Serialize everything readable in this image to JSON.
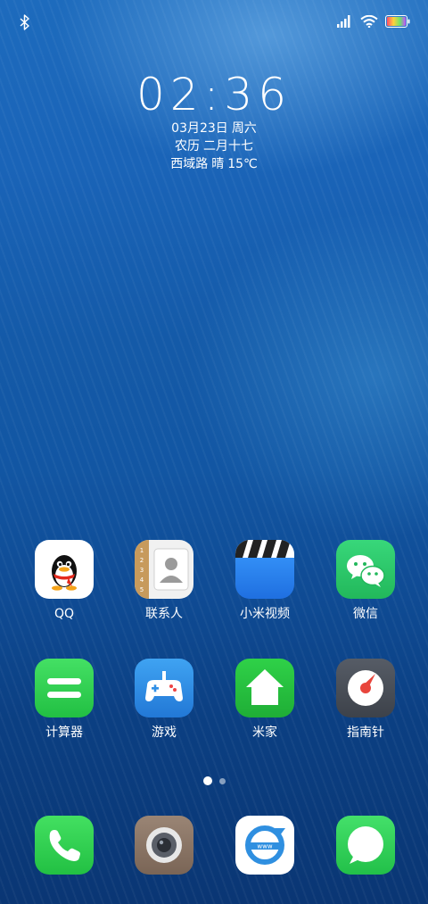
{
  "statusbar": {
    "bluetooth": "bluetooth-icon",
    "signal": "signal-icon",
    "wifi": "wifi-icon",
    "battery": "battery-icon"
  },
  "lockinfo": {
    "time": "02:36",
    "date": "03月23日",
    "weekday": "周六",
    "lunar_prefix": "农历",
    "lunar_date": "二月十七",
    "location": "西域路",
    "weather": "晴",
    "temperature": "15℃"
  },
  "apps_row1": [
    {
      "label": "QQ",
      "icon": "qq-penguin-icon"
    },
    {
      "label": "联系人",
      "icon": "contacts-icon"
    },
    {
      "label": "小米视频",
      "icon": "mi-video-icon"
    },
    {
      "label": "微信",
      "icon": "wechat-icon"
    }
  ],
  "apps_row2": [
    {
      "label": "计算器",
      "icon": "calculator-icon"
    },
    {
      "label": "游戏",
      "icon": "game-controller-icon"
    },
    {
      "label": "米家",
      "icon": "mi-home-icon"
    },
    {
      "label": "指南针",
      "icon": "compass-icon"
    }
  ],
  "page_indicator": {
    "current": 1,
    "total": 2
  },
  "dock": [
    {
      "icon": "phone-icon"
    },
    {
      "icon": "camera-icon"
    },
    {
      "icon": "browser-icon",
      "text": "www"
    },
    {
      "icon": "messages-icon"
    }
  ],
  "colors": {
    "qq_bg": "#ffffff",
    "contacts_bg": "#f2f2f2",
    "video_blue": "#2a7ff0",
    "wechat_green": "#2cc66a",
    "calculator_green": "#2fd14e",
    "game_blue": "#2f8fe6",
    "mihome_green": "#24c03e",
    "compass_gray": "#4a4f58",
    "phone_green": "#31cf4f",
    "camera_bg": "#8a7565",
    "browser_blue": "#2f8fe0",
    "messages_green": "#30cf55"
  }
}
